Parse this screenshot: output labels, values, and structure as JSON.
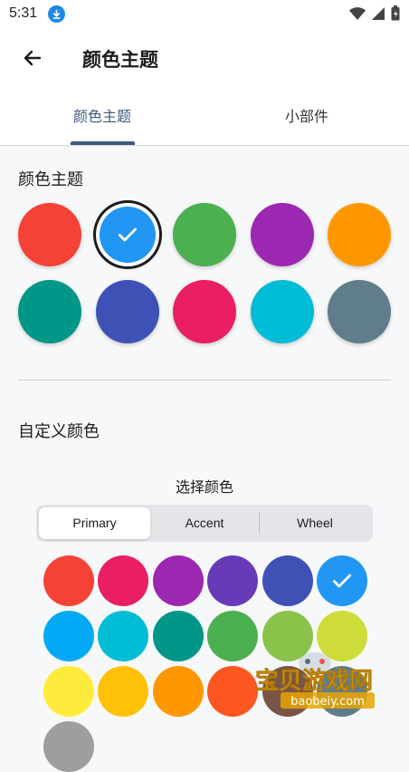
{
  "status": {
    "time": "5:31"
  },
  "appbar": {
    "title": "颜色主题"
  },
  "tabs": [
    {
      "label": "颜色主题"
    },
    {
      "label": "小部件"
    }
  ],
  "theme_section": {
    "title": "颜色主题",
    "colors": [
      "#f44336",
      "#2196f3",
      "#4caf50",
      "#9c27b0",
      "#ff9800",
      "#009688",
      "#3f51b5",
      "#e91e63",
      "#00bcd4",
      "#607d8b"
    ],
    "selected_index": 1
  },
  "custom_section": {
    "title": "自定义颜色",
    "picker_label": "选择颜色",
    "segments": [
      "Primary",
      "Accent",
      "Wheel"
    ],
    "active_segment": 0,
    "colors": [
      "#f44336",
      "#e91e63",
      "#9c27b0",
      "#673ab7",
      "#3f51b5",
      "#2196f3",
      "#03a9f4",
      "#00bcd4",
      "#009688",
      "#4caf50",
      "#8bc34a",
      "#cddc39",
      "#ffeb3b",
      "#ffc107",
      "#ff9800",
      "#ff5722",
      "#795548",
      "#607d8b",
      "#9e9e9e"
    ],
    "selected_index": 5
  },
  "watermark": {
    "brand": "宝贝游戏网",
    "domain": "baobeiy.com"
  }
}
